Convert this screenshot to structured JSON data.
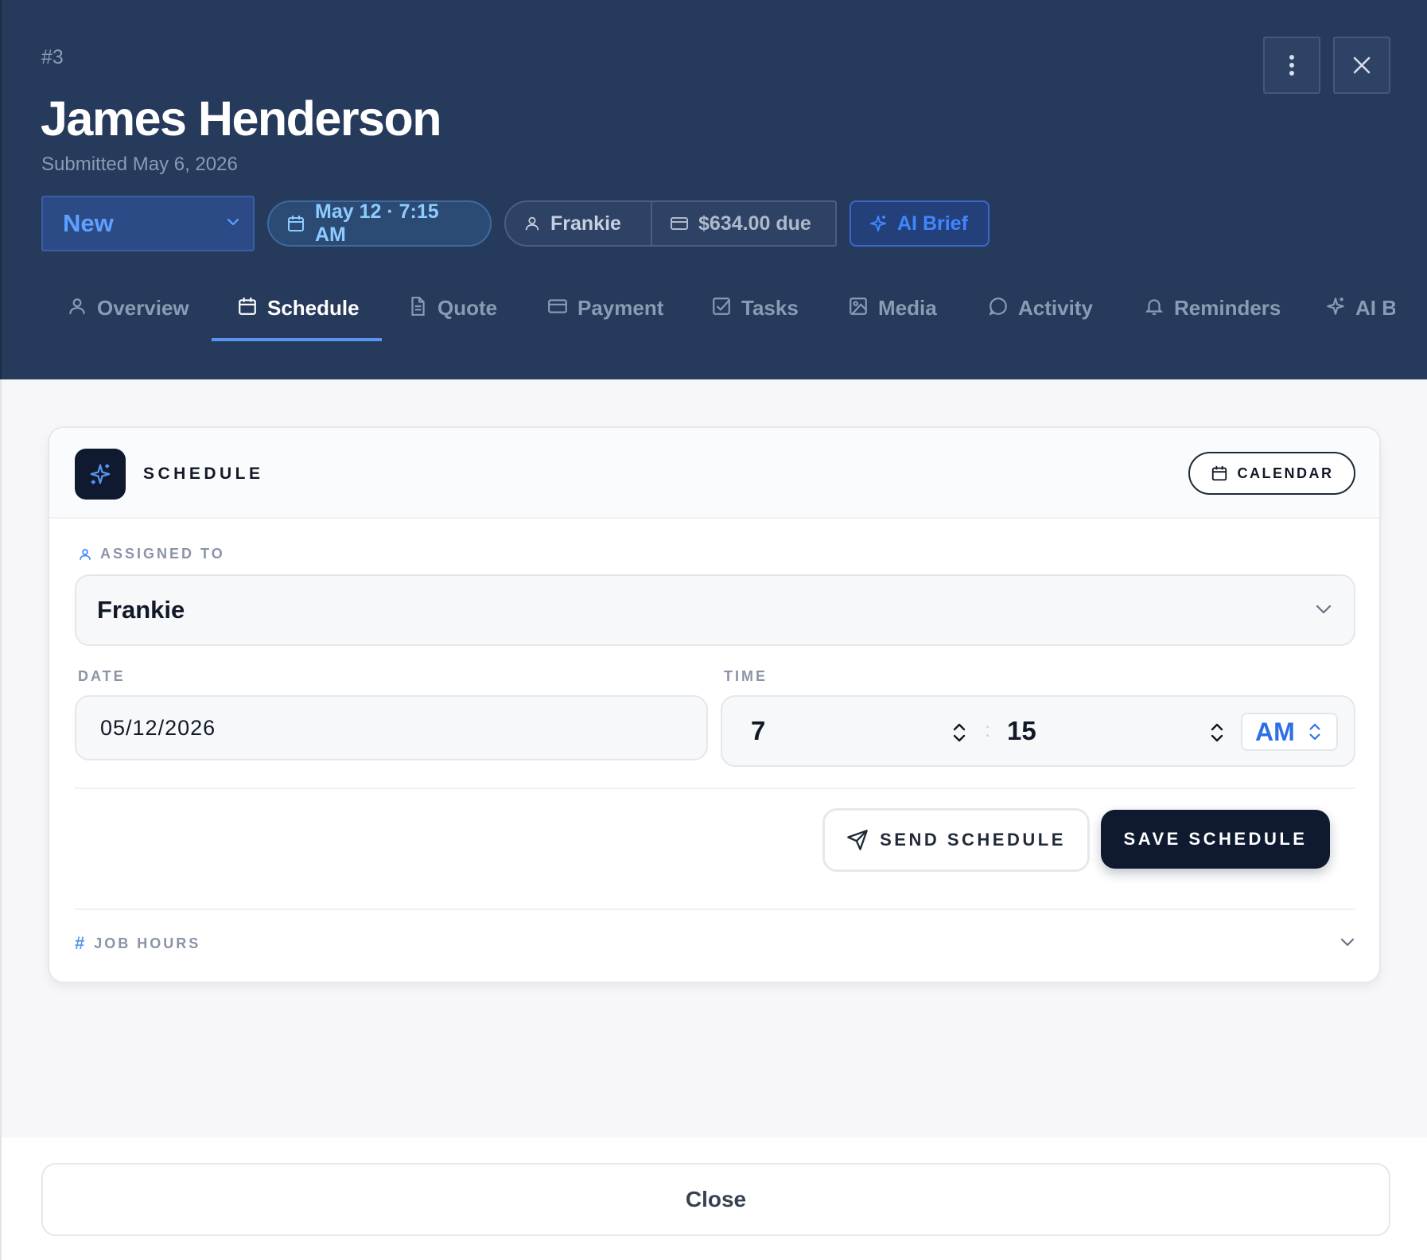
{
  "header": {
    "job_number": "#3",
    "customer_name": "James Henderson",
    "submitted": "Submitted May 6, 2026",
    "status": "New",
    "chips": {
      "datetime": "May 12 · 7:15 AM",
      "assignee": "Frankie",
      "amount_due": "$634.00 due",
      "ai_brief": "AI Brief"
    }
  },
  "tabs": [
    {
      "label": "Overview",
      "icon": "user-icon"
    },
    {
      "label": "Schedule",
      "icon": "calendar-icon",
      "active": true
    },
    {
      "label": "Quote",
      "icon": "document-icon"
    },
    {
      "label": "Payment",
      "icon": "credit-card-icon"
    },
    {
      "label": "Tasks",
      "icon": "checkbox-icon"
    },
    {
      "label": "Media",
      "icon": "image-icon"
    },
    {
      "label": "Activity",
      "icon": "chat-bubble-icon"
    },
    {
      "label": "Reminders",
      "icon": "bell-icon"
    },
    {
      "label": "AI B",
      "icon": "sparkle-icon"
    }
  ],
  "schedule": {
    "title": "SCHEDULE",
    "calendar_label": "CALENDAR",
    "assigned_label": "ASSIGNED TO",
    "assigned_value": "Frankie",
    "date_label": "DATE",
    "date_value": "05/12/2026",
    "time_label": "TIME",
    "time_hour": "7",
    "time_minute": "15",
    "time_period": "AM",
    "send_label": "SEND SCHEDULE",
    "save_label": "SAVE SCHEDULE",
    "job_hours_label": "JOB HOURS"
  },
  "footer": {
    "close_label": "Close"
  },
  "colors": {
    "header_bg": "#263a5c",
    "accent": "#3f86ff",
    "primary_button": "#0f1a30"
  }
}
